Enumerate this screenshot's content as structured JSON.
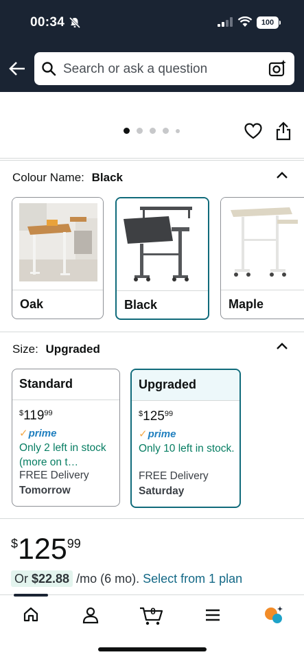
{
  "status_bar": {
    "time": "00:34",
    "battery": "100"
  },
  "search": {
    "placeholder": "Search or ask a question"
  },
  "colour": {
    "label": "Colour Name:",
    "selected": "Black",
    "options": [
      {
        "label": "Oak"
      },
      {
        "label": "Black"
      },
      {
        "label": "Maple"
      }
    ]
  },
  "size": {
    "label": "Size:",
    "selected": "Upgraded",
    "options": [
      {
        "label": "Standard",
        "price_symbol": "$",
        "price_whole": "119",
        "price_cents": "99",
        "prime": "prime",
        "stock": "Only 2 left in stock (more on t…",
        "delivery": "FREE Delivery",
        "delivery_day": "Tomorrow"
      },
      {
        "label": "Upgraded",
        "price_symbol": "$",
        "price_whole": "125",
        "price_cents": "99",
        "prime": "prime",
        "stock": "Only 10 left in stock.",
        "delivery": "FREE Delivery",
        "delivery_day": "Saturday"
      }
    ]
  },
  "price": {
    "symbol": "$",
    "whole": "125",
    "cents": "99"
  },
  "plan": {
    "prefix": "Or",
    "amount": "$22.88",
    "term": "/mo (6 mo).",
    "link": "Select from 1 plan"
  },
  "nav": {
    "cart_count": "0"
  },
  "colors": {
    "header": "#1a2433",
    "selected_border": "#0f6a7a",
    "stock_green": "#067d62",
    "link": "#136886",
    "prime_orange": "#f3a847"
  }
}
